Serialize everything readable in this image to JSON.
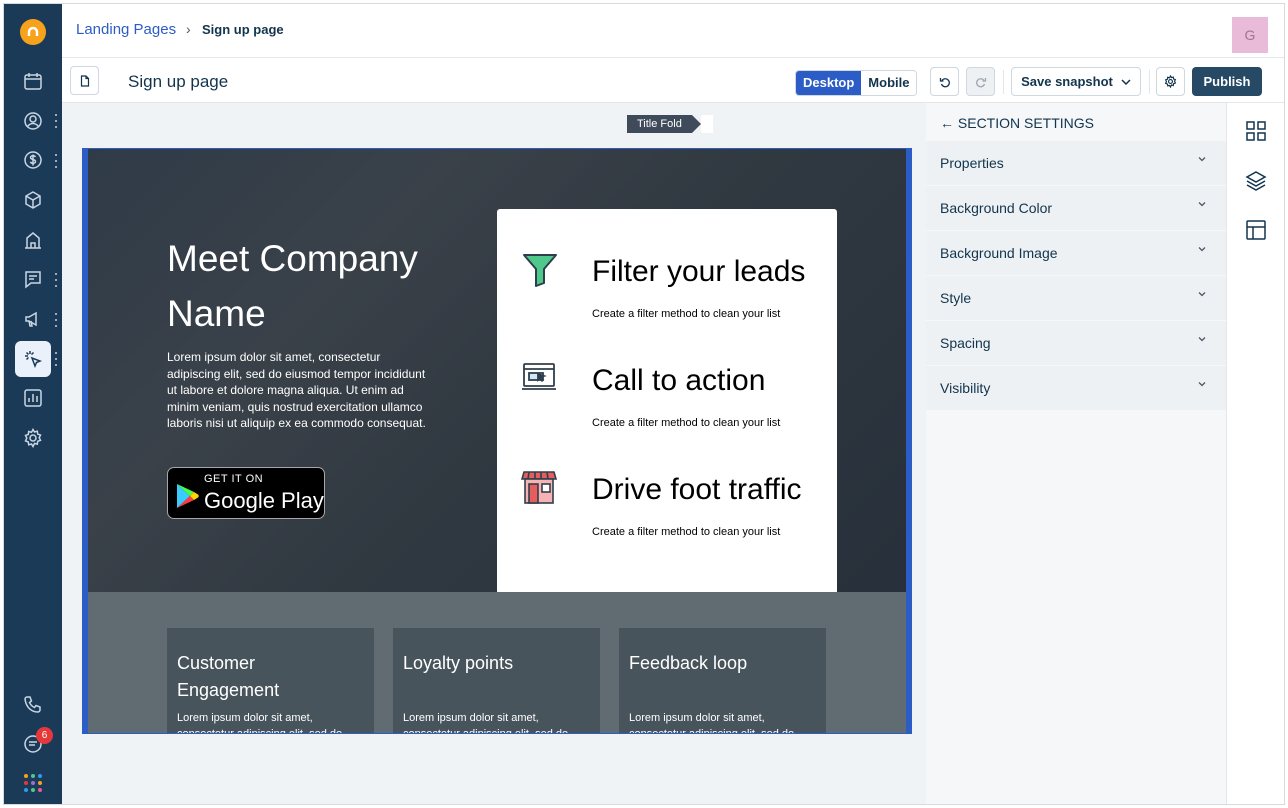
{
  "header": {
    "breadcrumb_parent": "Landing Pages",
    "breadcrumb_separator": "›",
    "breadcrumb_current": "Sign up page",
    "avatar_initial": "G"
  },
  "toolbar": {
    "page_name": "Sign up page",
    "view_options": [
      "Desktop",
      "Mobile"
    ],
    "selected_view": "Desktop",
    "save_snapshot_label": "Save snapshot",
    "publish_label": "Publish"
  },
  "nav": {
    "notification_count": "6",
    "icons": [
      "calendar-icon",
      "contacts-icon",
      "deals-icon",
      "products-icon",
      "accounts-icon",
      "conversations-icon",
      "campaigns-icon",
      "landing-pages-icon",
      "reports-icon",
      "settings-icon",
      "phone-icon",
      "chat-icon",
      "apps-icon"
    ]
  },
  "canvas": {
    "fold_label": "Title Fold",
    "hero": {
      "title": "Meet Company Name",
      "body": "Lorem ipsum dolor sit amet, consectetur adipiscing elit, sed do eiusmod tempor incididunt ut labore et dolore magna aliqua. Ut enim ad minim veniam, quis nostrud exercitation ullamco laboris nisi ut aliquip ex ea commodo consequat.",
      "badge_small": "GET IT ON",
      "badge_big": "Google Play"
    },
    "features": [
      {
        "title": "Filter your leads",
        "desc": "Create a filter method to clean your list",
        "icon": "funnel-icon"
      },
      {
        "title": "Call to action",
        "desc": "Create a filter method to clean your list",
        "icon": "browser-click-icon"
      },
      {
        "title": "Drive foot traffic",
        "desc": "Create a filter method to clean your list",
        "icon": "storefront-icon"
      }
    ],
    "lower_cards": [
      {
        "title": "Customer Engagement",
        "desc": "Lorem ipsum dolor sit amet, consectetur adipiscing elit, sed do"
      },
      {
        "title": "Loyalty points",
        "desc": "Lorem ipsum dolor sit amet, consectetur adipiscing elit, sed do"
      },
      {
        "title": "Feedback loop",
        "desc": "Lorem ipsum dolor sit amet, consectetur adipiscing elit, sed do"
      }
    ]
  },
  "panel": {
    "title": "← SECTION SETTINGS",
    "sections": [
      "Properties",
      "Background Color",
      "Background Image",
      "Style",
      "Spacing",
      "Visibility"
    ]
  },
  "colors": {
    "nav_bg": "#1b3a57",
    "accent": "#2c5cc5",
    "publish": "#264966",
    "badge": "#e5383b",
    "funnel": "#4ec98b",
    "store": "#e55e5e"
  }
}
